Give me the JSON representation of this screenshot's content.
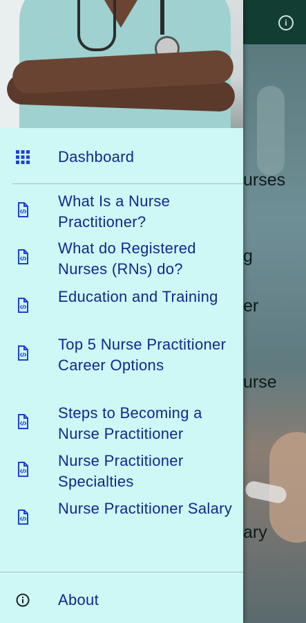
{
  "background": {
    "partial_texts": [
      "urses",
      "g",
      "er",
      "urse",
      "ary"
    ],
    "appbar_color": "#123d33"
  },
  "drawer": {
    "background": "#cdf8f5",
    "dashboard": {
      "label": "Dashboard",
      "icon": "grid-icon"
    },
    "items": [
      {
        "label": "What Is a Nurse Practitioner?",
        "icon": "document-code-icon"
      },
      {
        "label": "What do Registered Nurses (RNs) do?",
        "icon": "document-code-icon"
      },
      {
        "label": "Education and Training",
        "icon": "document-code-icon"
      },
      {
        "label": "Top 5 Nurse Practitioner Career Options",
        "icon": "document-code-icon"
      },
      {
        "label": "Steps to Becoming a Nurse Practitioner",
        "icon": "document-code-icon"
      },
      {
        "label": "Nurse Practitioner Specialties",
        "icon": "document-code-icon"
      },
      {
        "label": "Nurse Practitioner Salary",
        "icon": "document-code-icon"
      }
    ],
    "about": {
      "label": "About",
      "icon": "info-icon"
    },
    "text_color": "#0d2a8c"
  }
}
